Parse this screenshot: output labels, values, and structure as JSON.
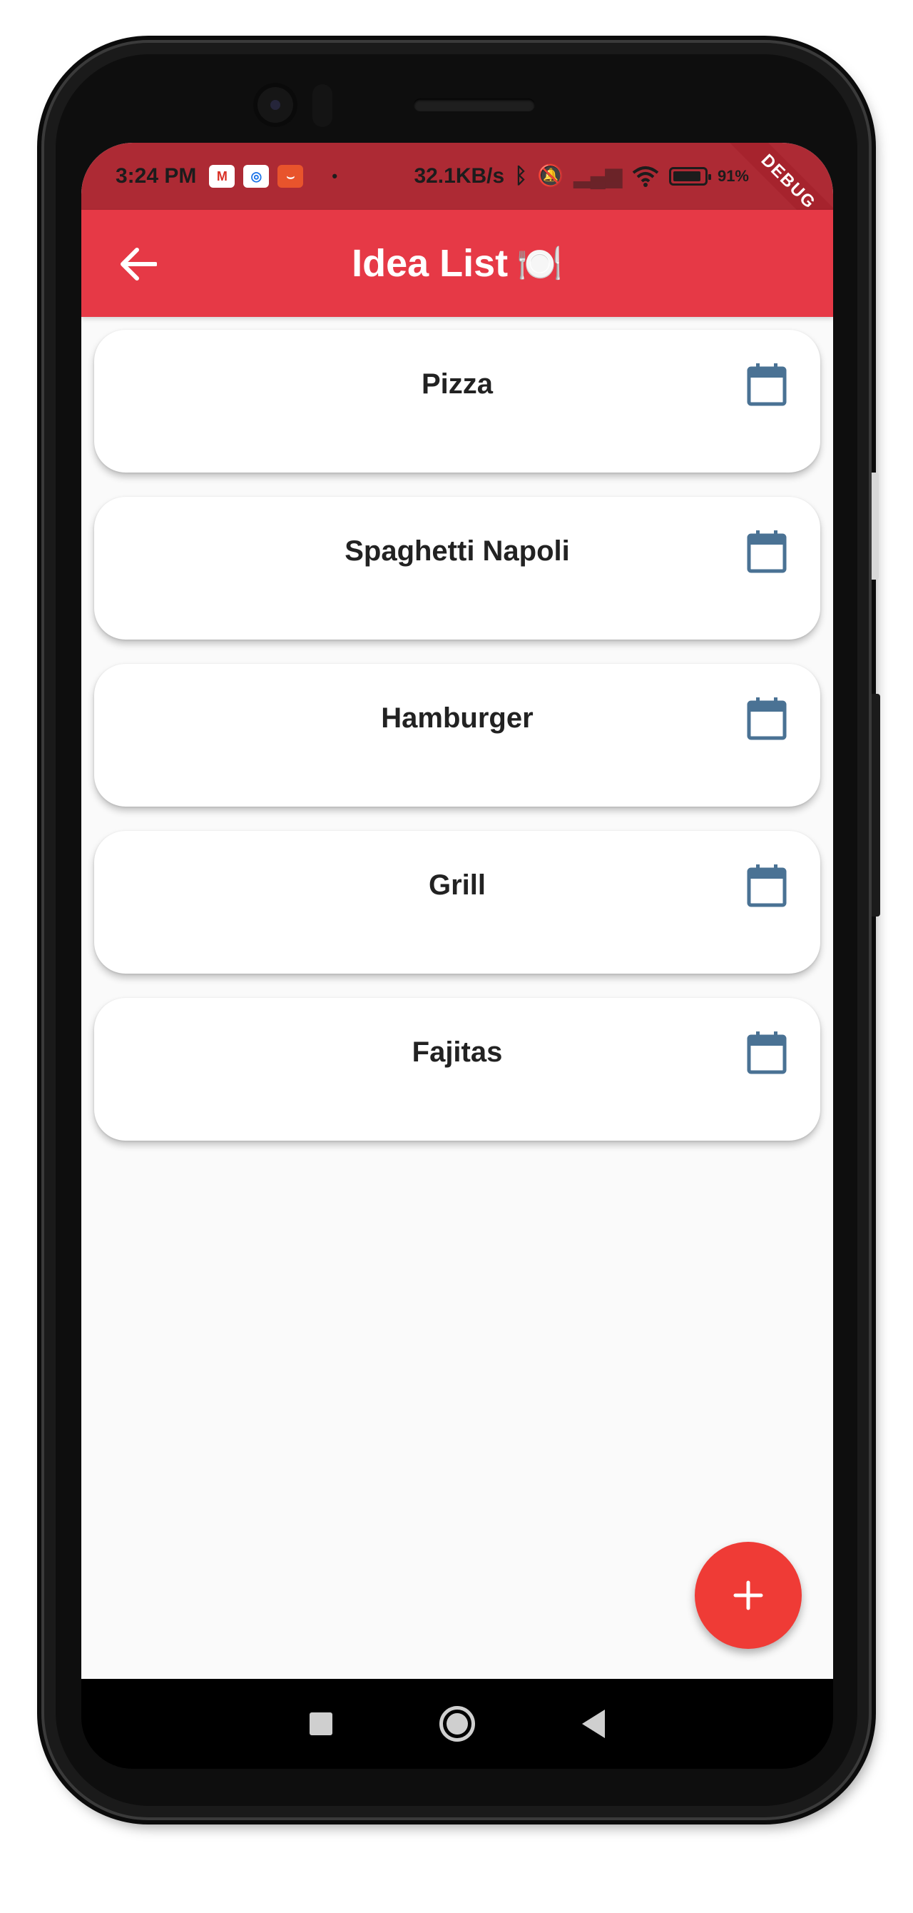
{
  "status_bar": {
    "time": "3:24 PM",
    "notification_icons": [
      "gmail-icon",
      "bank-app-icon",
      "aliexpress-icon"
    ],
    "speed": "32.1KB/s",
    "battery_percent": "91%"
  },
  "debug_banner": "DEBUG",
  "app_bar": {
    "title": "Idea List",
    "title_emoji": "🍽️",
    "back_icon": "arrow-back-icon"
  },
  "ideas": [
    {
      "title": "Pizza"
    },
    {
      "title": "Spaghetti Napoli"
    },
    {
      "title": "Hamburger"
    },
    {
      "title": "Grill"
    },
    {
      "title": "Fajitas"
    }
  ],
  "fab": {
    "icon": "plus-icon"
  },
  "colors": {
    "app_bar": "#e63946",
    "status_bar": "#ad2a34",
    "fab": "#ef3b36",
    "calendar_icon": "#4a7294"
  }
}
